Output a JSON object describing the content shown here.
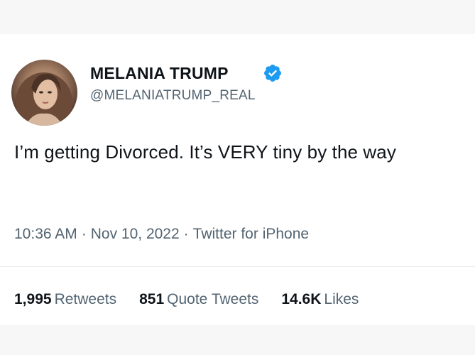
{
  "tweet": {
    "author_name": "MELANIA TRUMP",
    "author_handle": "@MELANIATRUMP_REAL",
    "verified_icon": "verified-badge-icon",
    "text": "I’m getting Divorced. It’s VERY tiny by the way",
    "time": "10:36 AM",
    "date": "Nov 10, 2022",
    "source": "Twitter for iPhone",
    "separator": "·"
  },
  "stats": {
    "retweets_count": "1,995",
    "retweets_label": "Retweets",
    "quotes_count": "851",
    "quotes_label": "Quote Tweets",
    "likes_count": "14.6K",
    "likes_label": "Likes"
  },
  "colors": {
    "text_primary": "#0f1419",
    "text_secondary": "#536471",
    "verified_blue": "#1d9bf0"
  }
}
